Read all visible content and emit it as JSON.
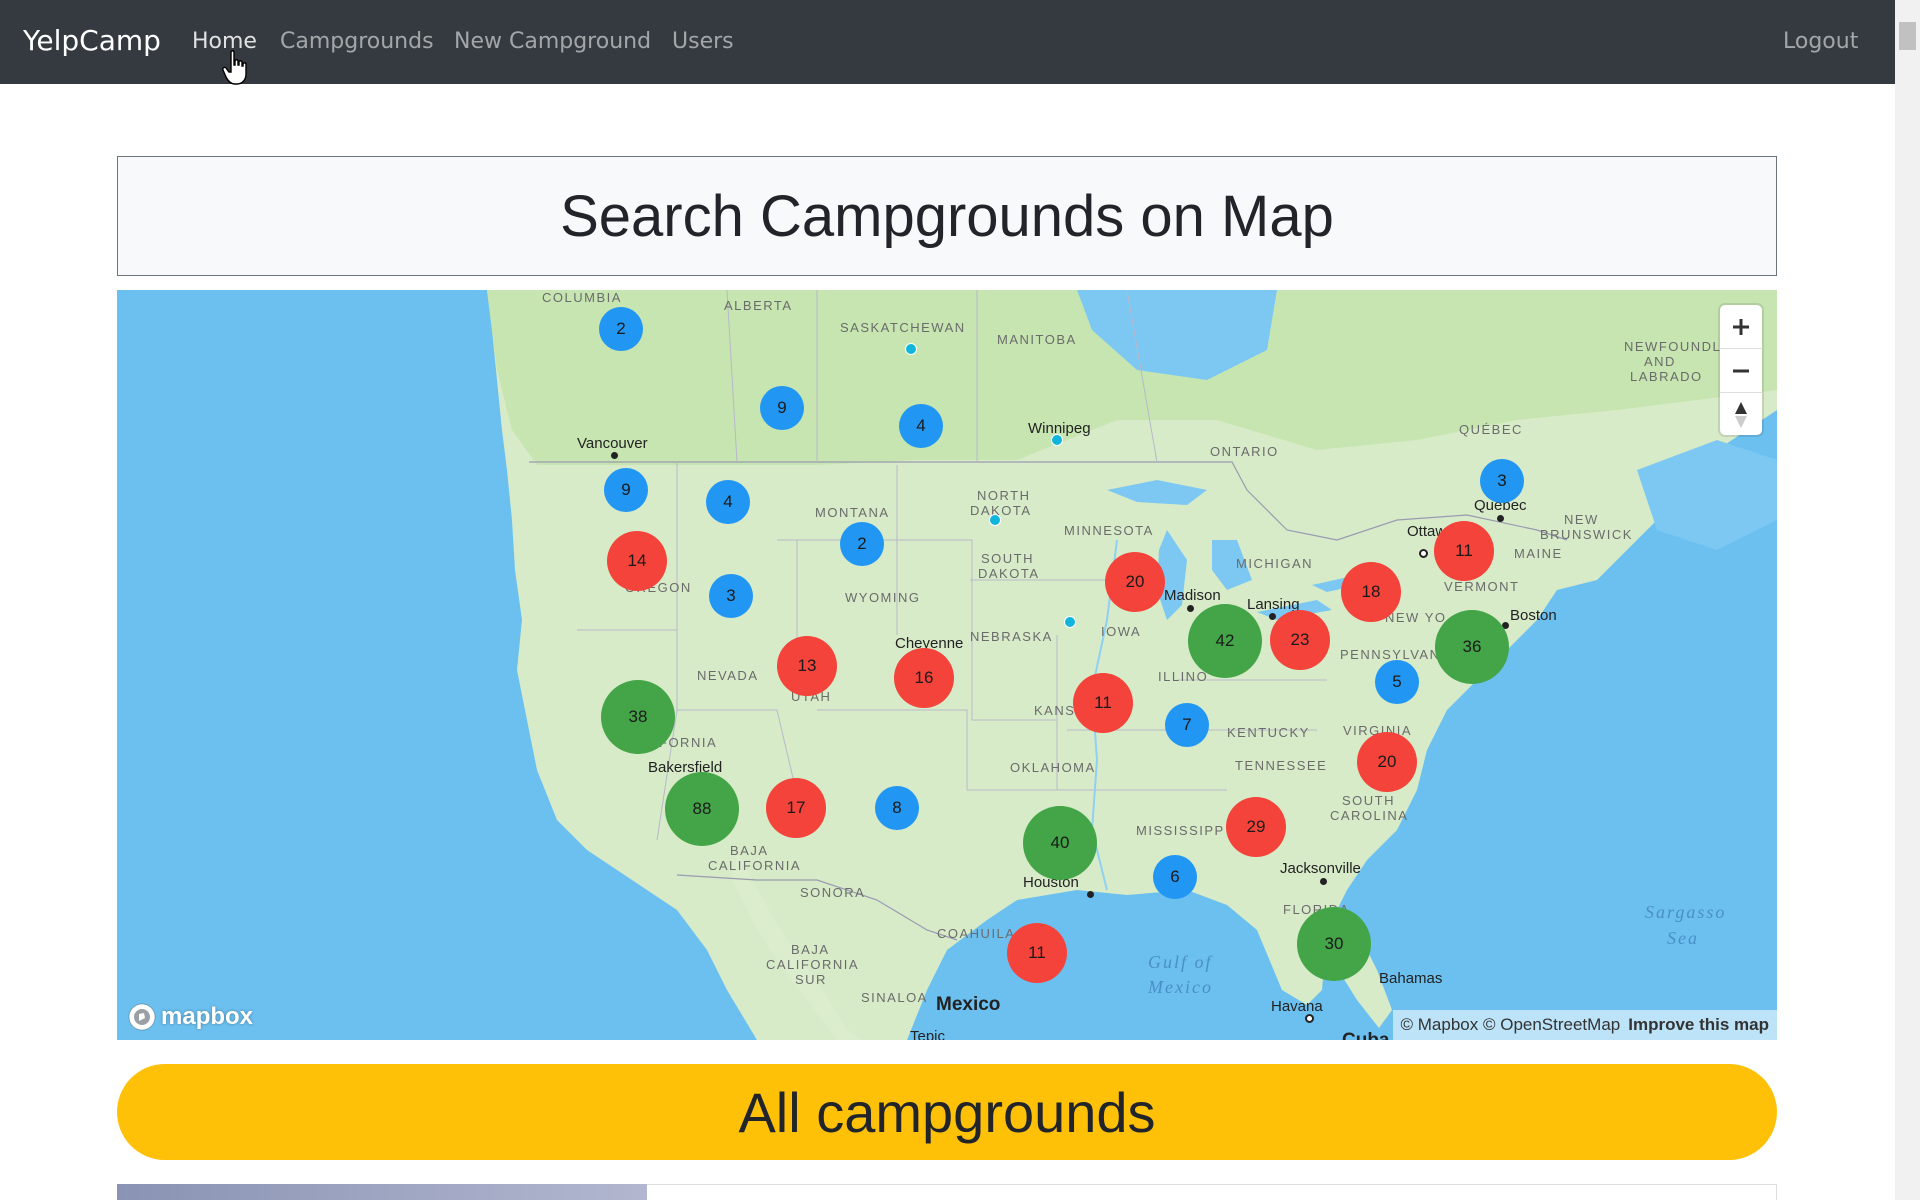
{
  "nav": {
    "brand": "YelpCamp",
    "links": [
      "Home",
      "Campgrounds",
      "New Campground",
      "Users"
    ],
    "logout": "Logout"
  },
  "page": {
    "map_title": "Search Campgrounds on Map",
    "all_title": "All campgrounds"
  },
  "map": {
    "regions": {
      "columbia": "COLUMBIA",
      "alberta": "ALBERTA",
      "saskatchewan": "SASKATCHEWAN",
      "manitoba": "MANITOBA",
      "ontario": "ONTARIO",
      "quebec_prov": "QUÉBEC",
      "newfoundland_1": "NEWFOUNDLA",
      "newfoundland_2": "AND",
      "newfoundland_3": "LABRADO",
      "new_brunswick_1": "NEW",
      "new_brunswick_2": "BRUNSWICK",
      "montana": "MONTANA",
      "north_dakota_1": "NORTH",
      "north_dakota_2": "DAKOTA",
      "south_dakota_1": "SOUTH",
      "south_dakota_2": "DAKOTA",
      "minnesota": "MINNESOTA",
      "michigan": "MICHIGAN",
      "maine": "MAINE",
      "vermont": "VERMONT",
      "new_york": "NEW YO",
      "oregon": "OREGON",
      "wyoming": "WYOMING",
      "iowa": "IOWA",
      "nebraska": "NEBRASKA",
      "pennsylvania": "PENNSYLVANIA",
      "nevada": "NEVADA",
      "utah": "UTAH",
      "illinois": "ILLINO",
      "kansas": "KANSAS",
      "kentucky": "KENTUCKY",
      "virginia": "VIRGINIA",
      "california": "FORNIA",
      "oklahoma": "OKLAHOMA",
      "tennessee": "TENNESSEE",
      "south_carolina_1": "SOUTH",
      "south_carolina_2": "CAROLINA",
      "mississippi": "MISSISSIPP",
      "baja_california_1": "BAJA",
      "baja_california_2": "CALIFORNIA",
      "sonora": "SONORA",
      "baja_sur_1": "BAJA",
      "baja_sur_2": "CALIFORNIA",
      "baja_sur_3": "SUR",
      "coahuila": "COAHUILA",
      "sinaloa": "SINALOA",
      "florida": "FLORIDA"
    },
    "cities": {
      "vancouver": "Vancouver",
      "winnipeg": "Winnipeg",
      "quebec": "Quebec",
      "ottawa": "Ottawa",
      "boston": "Boston",
      "madison": "Madison",
      "lansing": "Lansing",
      "cheyenne": "Cheyenne",
      "bakersfield": "Bakersfield",
      "houston": "Houston",
      "jacksonville": "Jacksonville",
      "mexico": "Mexico",
      "bahamas": "Bahamas",
      "havana": "Havana",
      "tepic": "Tepic",
      "cuba": "Cuba"
    },
    "water": {
      "gulf_1": "Gulf of",
      "gulf_2": "Mexico",
      "sargasso_1": "Sargasso",
      "sargasso_2": "Sea"
    },
    "clusters": [
      "2",
      "9",
      "4",
      "9",
      "4",
      "2",
      "14",
      "3",
      "20",
      "3",
      "11",
      "18",
      "23",
      "42",
      "36",
      "13",
      "16",
      "38",
      "11",
      "5",
      "7",
      "20",
      "88",
      "17",
      "8",
      "40",
      "29",
      "6",
      "30",
      "11"
    ],
    "logo": "mapbox",
    "attribution": "© Mapbox © OpenStreetMap",
    "improve": "Improve this map",
    "colors": {
      "small": "#2196f3",
      "medium": "#f4433a",
      "large": "#43a547",
      "unclustered": "#11b4da"
    }
  }
}
